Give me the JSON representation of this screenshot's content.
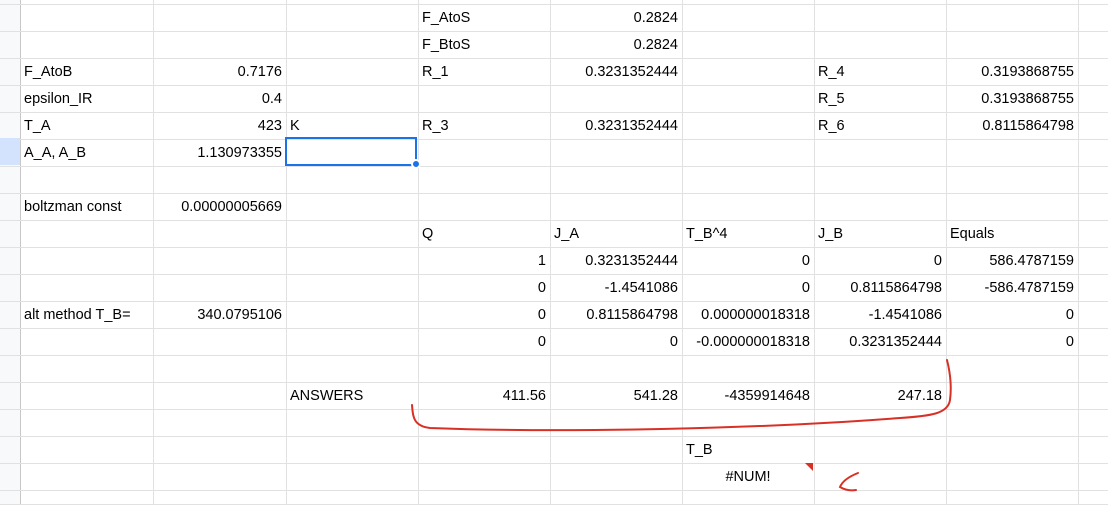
{
  "sheet": {
    "rows": [
      [
        {
          "c": 3,
          "v": "F_AtoS"
        },
        {
          "c": 4,
          "v": "0.2824"
        }
      ],
      [
        {
          "c": 3,
          "v": "F_BtoS"
        },
        {
          "c": 4,
          "v": "0.2824"
        }
      ],
      [
        {
          "c": 0,
          "v": "F_AtoB"
        },
        {
          "c": 1,
          "v": "0.7176"
        },
        {
          "c": 3,
          "v": "R_1"
        },
        {
          "c": 4,
          "v": "0.3231352444"
        },
        {
          "c": 6,
          "v": "R_4"
        },
        {
          "c": 7,
          "v": "0.3193868755"
        }
      ],
      [
        {
          "c": 0,
          "v": "epsilon_IR"
        },
        {
          "c": 1,
          "v": "0.4"
        },
        {
          "c": 6,
          "v": "R_5"
        },
        {
          "c": 7,
          "v": "0.3193868755"
        }
      ],
      [
        {
          "c": 0,
          "v": "T_A"
        },
        {
          "c": 1,
          "v": "423"
        },
        {
          "c": 2,
          "v": "K"
        },
        {
          "c": 3,
          "v": "R_3"
        },
        {
          "c": 4,
          "v": "0.3231352444"
        },
        {
          "c": 6,
          "v": "R_6"
        },
        {
          "c": 7,
          "v": "0.8115864798"
        }
      ],
      [
        {
          "c": 0,
          "v": "A_A, A_B"
        },
        {
          "c": 1,
          "v": "1.130973355"
        }
      ],
      [],
      [
        {
          "c": 0,
          "v": "boltzman const"
        },
        {
          "c": 1,
          "v": "0.00000005669"
        }
      ],
      [
        {
          "c": 3,
          "v": "Q"
        },
        {
          "c": 4,
          "v": "J_A"
        },
        {
          "c": 5,
          "v": "T_B^4"
        },
        {
          "c": 6,
          "v": "J_B"
        },
        {
          "c": 7,
          "v": "Equals"
        }
      ],
      [
        {
          "c": 3,
          "v": "1"
        },
        {
          "c": 4,
          "v": "0.3231352444"
        },
        {
          "c": 5,
          "v": "0"
        },
        {
          "c": 6,
          "v": "0"
        },
        {
          "c": 7,
          "v": "586.4787159"
        }
      ],
      [
        {
          "c": 3,
          "v": "0"
        },
        {
          "c": 4,
          "v": "-1.4541086"
        },
        {
          "c": 5,
          "v": "0"
        },
        {
          "c": 6,
          "v": "0.8115864798"
        },
        {
          "c": 7,
          "v": "-586.4787159"
        }
      ],
      [
        {
          "c": 0,
          "v": "alt method T_B="
        },
        {
          "c": 1,
          "v": "340.0795106"
        },
        {
          "c": 3,
          "v": "0"
        },
        {
          "c": 4,
          "v": "0.8115864798"
        },
        {
          "c": 5,
          "v": "0.000000018318"
        },
        {
          "c": 6,
          "v": "-1.4541086"
        },
        {
          "c": 7,
          "v": "0"
        }
      ],
      [
        {
          "c": 3,
          "v": "0"
        },
        {
          "c": 4,
          "v": "0"
        },
        {
          "c": 5,
          "v": "-0.000000018318"
        },
        {
          "c": 6,
          "v": "0.3231352444"
        },
        {
          "c": 7,
          "v": "0"
        }
      ],
      [],
      [
        {
          "c": 2,
          "v": "ANSWERS"
        },
        {
          "c": 3,
          "v": "411.56"
        },
        {
          "c": 4,
          "v": "541.28"
        },
        {
          "c": 5,
          "v": "-4359914648"
        },
        {
          "c": 6,
          "v": "247.18"
        }
      ],
      [],
      [
        {
          "c": 5,
          "v": "T_B"
        }
      ],
      [
        {
          "c": 5,
          "v": "#NUM!"
        }
      ],
      []
    ],
    "selected_cell": "C6",
    "colors": {
      "selection": "#1a73e8",
      "annotation": "#d93025",
      "error_marker": "#d93025",
      "gridline": "#e1e1e1"
    }
  }
}
